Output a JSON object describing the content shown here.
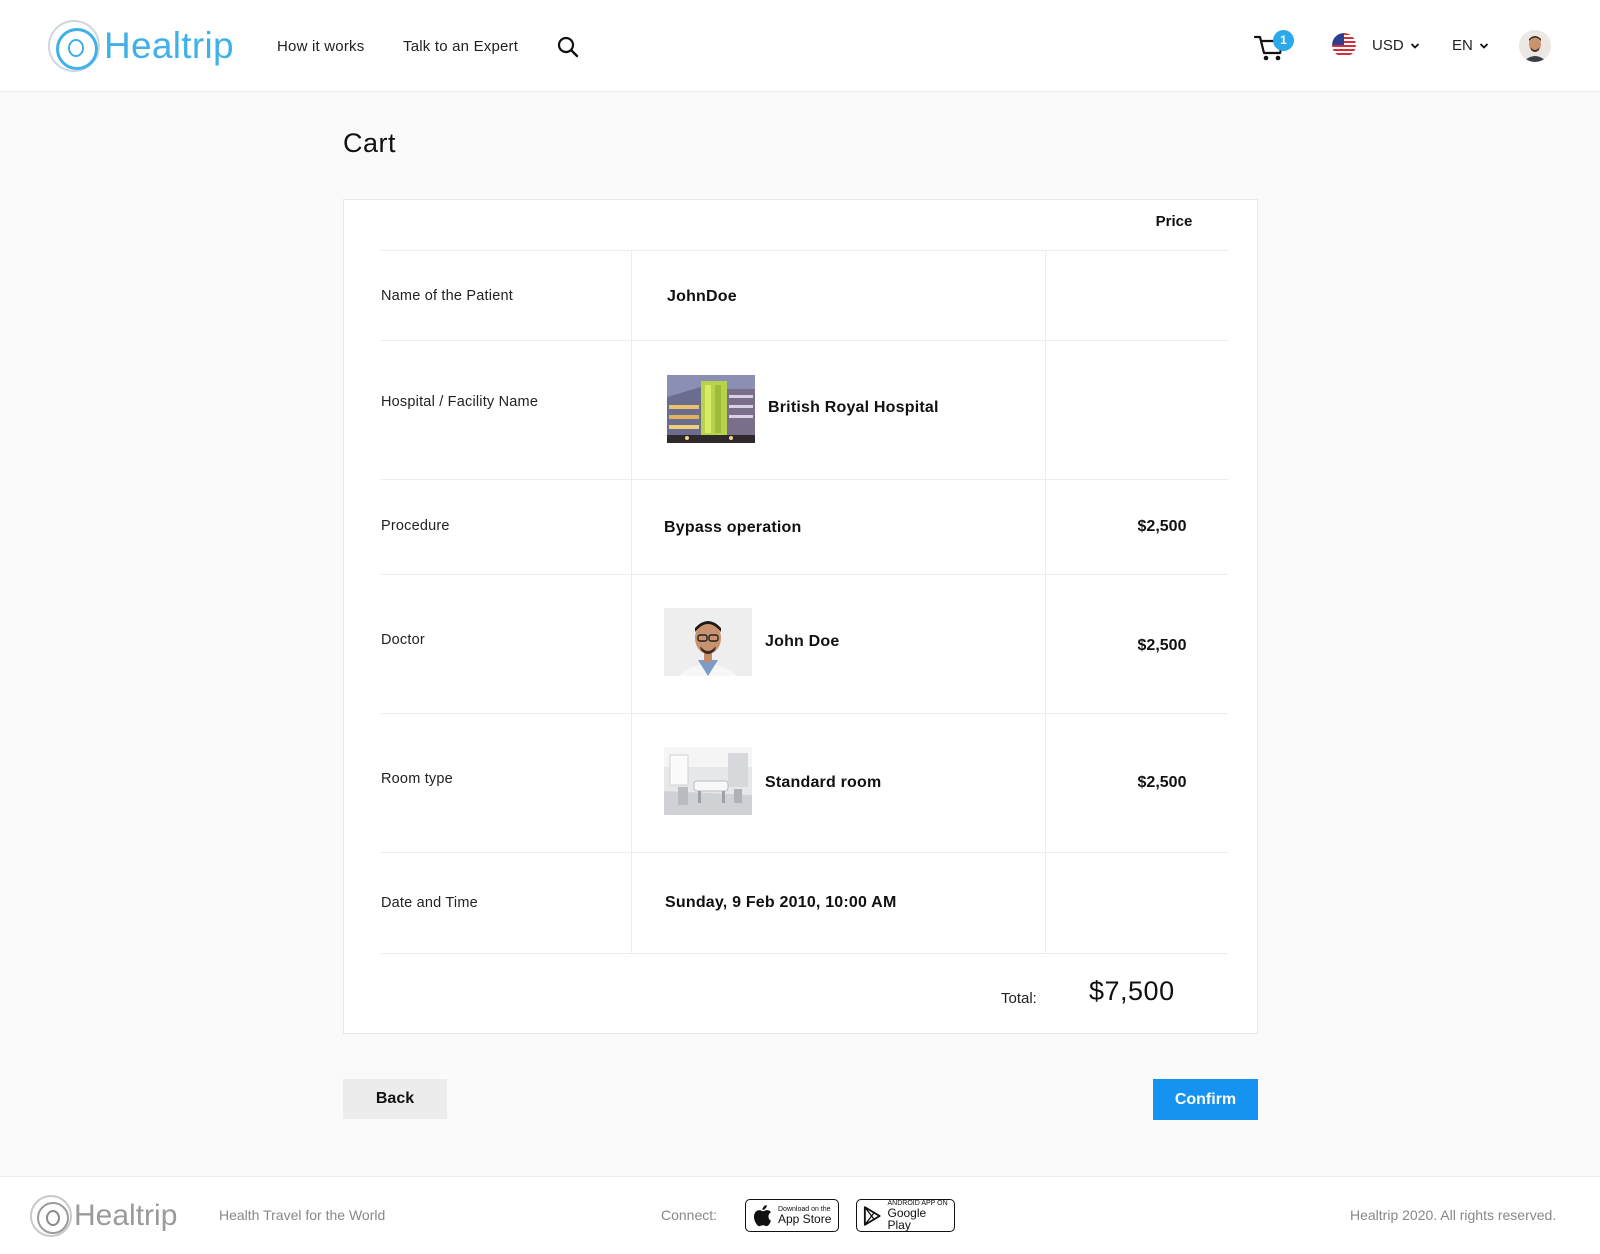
{
  "header": {
    "brand": "Healtrip",
    "nav": {
      "how_it_works": "How it works",
      "talk_to_expert": "Talk to an Expert"
    },
    "cart_count": "1",
    "currency": "USD",
    "language": "EN"
  },
  "page": {
    "title": "Cart"
  },
  "cart": {
    "price_header": "Price",
    "rows": [
      {
        "label": "Name of the Patient",
        "value": "JohnDoe",
        "price": ""
      },
      {
        "label": "Hospital / Facility Name",
        "value": "British Royal Hospital",
        "price": ""
      },
      {
        "label": "Procedure",
        "value": "Bypass operation",
        "price": "$2,500"
      },
      {
        "label": "Doctor",
        "value": "John Doe",
        "price": "$2,500"
      },
      {
        "label": "Room type",
        "value": "Standard room",
        "price": "$2,500"
      },
      {
        "label": "Date and Time",
        "value": "Sunday, 9 Feb 2010, 10:00 AM",
        "price": ""
      }
    ],
    "total_label": "Total:",
    "total_value": "$7,500"
  },
  "actions": {
    "back": "Back",
    "confirm": "Confirm"
  },
  "footer": {
    "brand": "Healtrip",
    "tagline": "Health Travel for the World",
    "connect": "Connect:",
    "app_store": {
      "small": "Download on the",
      "big": "App Store"
    },
    "google_play": {
      "small": "ANDROID APP ON",
      "big": "Google Play"
    },
    "copyright": "Healtrip 2020. All rights reserved."
  },
  "colors": {
    "brand": "#3fb1e8",
    "primary_button": "#1692f0",
    "badge": "#2ca8ec",
    "secondary_button": "#ececec"
  },
  "icons": [
    "search-icon",
    "cart-icon",
    "us-flag-icon",
    "chevron-down-icon",
    "apple-icon",
    "google-play-icon"
  ]
}
